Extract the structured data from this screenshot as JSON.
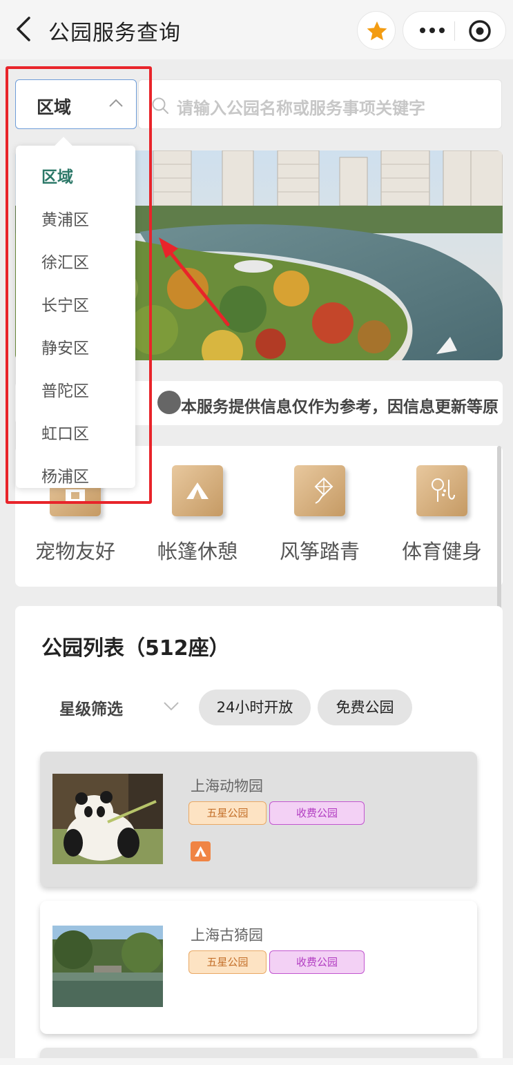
{
  "header": {
    "title": "公园服务查询"
  },
  "search": {
    "region_label": "区域",
    "placeholder": "请输入公园名称或服务事项关键字"
  },
  "notice": {
    "prefix": "。",
    "text": "本服务提供信息仅作为参考，因信息更新等原"
  },
  "categories": [
    {
      "label": "宠物友好",
      "icon": "pet-icon"
    },
    {
      "label": "帐篷休憩",
      "icon": "tent-icon"
    },
    {
      "label": "风筝踏青",
      "icon": "kite-icon"
    },
    {
      "label": "体育健身",
      "icon": "fitness-icon"
    }
  ],
  "park_list": {
    "title": "公园列表（512座）",
    "filters": {
      "rating": "星级筛选",
      "open24": "24小时开放",
      "free": "免费公园"
    },
    "parks": [
      {
        "name": "上海动物园",
        "tags": [
          "五星公园",
          "收费公园"
        ]
      },
      {
        "name": "上海古猗园",
        "tags": [
          "五星公园",
          "收费公园"
        ]
      }
    ]
  },
  "dropdown": {
    "items": [
      "区域",
      "黄浦区",
      "徐汇区",
      "长宁区",
      "静安区",
      "普陀区",
      "虹口区",
      "杨浦区"
    ]
  },
  "colors": {
    "accent_green": "#2c7868",
    "highlight_red": "#e8242a",
    "star_orange": "#f39c12",
    "tag_orange": "#c4702b",
    "tag_purple": "#b13cc1"
  }
}
